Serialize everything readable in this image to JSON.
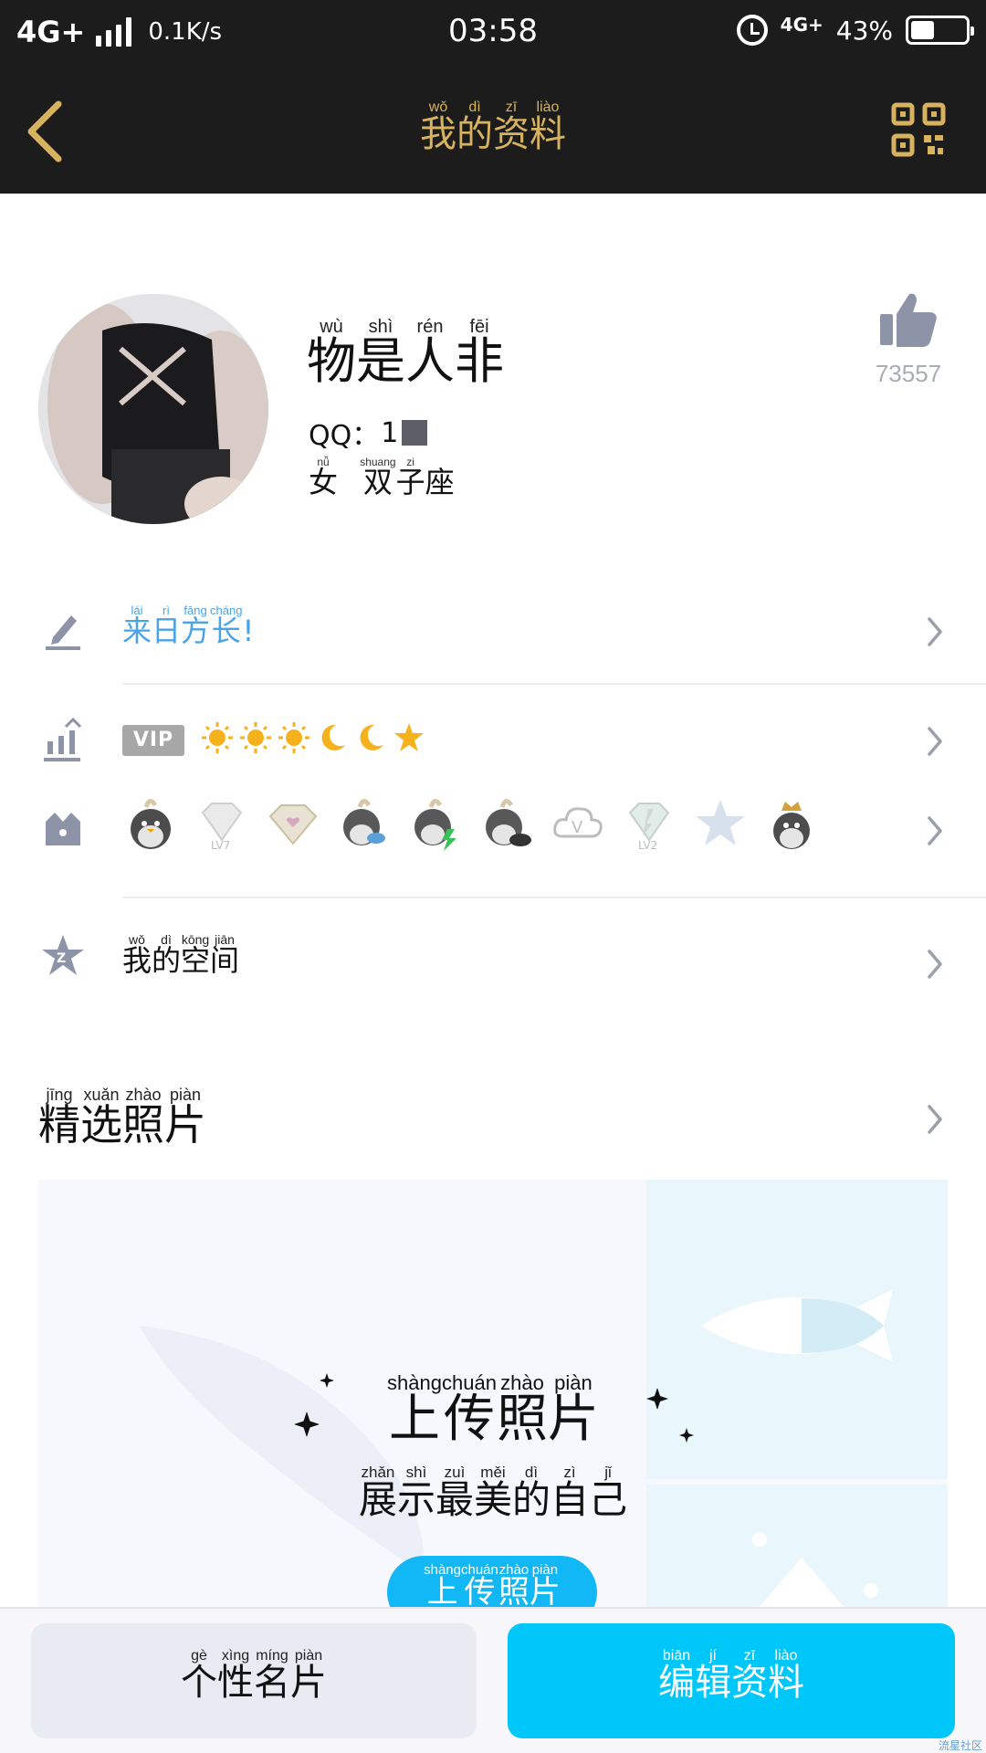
{
  "status_bar": {
    "network": "4G+",
    "speed": "0.1K/s",
    "time": "03:58",
    "network2": "4G+",
    "battery": "43%",
    "battery_level": 0.43
  },
  "header": {
    "title_pinyin": [
      "wǒ",
      "dì",
      "zī",
      "liào"
    ],
    "title_chars": [
      "我",
      "的",
      "资",
      "料"
    ],
    "accent_color": "#d8b35f"
  },
  "profile": {
    "nickname_pinyin": [
      "wù",
      "shì",
      "rén",
      "fēi"
    ],
    "nickname_chars": [
      "物",
      "是",
      "人",
      "非"
    ],
    "qq_label": "QQ：",
    "qq_visible": "1",
    "gender_pinyin": [
      "nǚ"
    ],
    "gender_chars": [
      "女"
    ],
    "zodiac_pinyin": [
      "shuang",
      "zi",
      ""
    ],
    "zodiac_chars": [
      "双",
      "子",
      "座"
    ],
    "likes": "73557"
  },
  "signature": {
    "pinyin": [
      "lái",
      "rì",
      "fāng",
      "cháng"
    ],
    "chars": [
      "来",
      "日",
      "方",
      "长"
    ],
    "suffix": "!"
  },
  "vip": {
    "badge": "VIP",
    "levels": [
      "sun",
      "sun",
      "sun",
      "moon",
      "moon",
      "star"
    ]
  },
  "badges": [
    "qq-penguin-icon",
    "diamond-lv7-icon",
    "heart-diamond-icon",
    "penguin-fish-icon",
    "penguin-bolt-icon",
    "penguin-whale-icon",
    "cloud-v-icon",
    "diamond-lv2-icon",
    "star-icon",
    "penguin-crown-icon"
  ],
  "qzone": {
    "pinyin": [
      "wǒ",
      "dì",
      "kōng",
      "jiān"
    ],
    "chars": [
      "我",
      "的",
      "空",
      "间"
    ]
  },
  "photos": {
    "section_pinyin": [
      "jīng",
      "xuǎn",
      "zhào",
      "piàn"
    ],
    "section_chars": [
      "精",
      "选",
      "照",
      "片"
    ],
    "upload_title_pinyin": [
      "shàng",
      "chuán",
      "zhào",
      "piàn"
    ],
    "upload_title_chars": [
      "上",
      "传",
      "照",
      "片"
    ],
    "upload_sub_pinyin": [
      "zhǎn",
      "shì",
      "zuì",
      "měi",
      "dì",
      "zì",
      "jǐ"
    ],
    "upload_sub_chars": [
      "展",
      "示",
      "最",
      "美",
      "的",
      "自",
      "己"
    ],
    "upload_btn_pinyin": [
      "shàng",
      "chuán",
      "zhào",
      "piàn"
    ],
    "upload_btn_chars": [
      "上",
      "传",
      "照",
      "片"
    ]
  },
  "bottom": {
    "card_pinyin": [
      "gè",
      "xìng",
      "míng",
      "piàn"
    ],
    "card_chars": [
      "个",
      "性",
      "名",
      "片"
    ],
    "edit_pinyin": [
      "biān",
      "jí",
      "zī",
      "liào"
    ],
    "edit_chars": [
      "编",
      "辑",
      "资",
      "料"
    ],
    "edit_color": "#00c7fa"
  },
  "watermark": "流星社区"
}
